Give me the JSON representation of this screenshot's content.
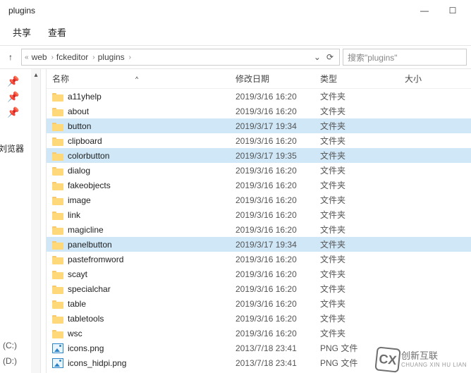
{
  "window": {
    "title": "plugins",
    "minimize": "—",
    "maximize": "☐"
  },
  "tabs": {
    "share": "共享",
    "view": "查看"
  },
  "breadcrumb": {
    "back_icon": "↑",
    "pre": "«",
    "items": [
      "web",
      "fckeditor",
      "plugins"
    ],
    "sep": "›",
    "dropdown": "⌄",
    "refresh": "⟳"
  },
  "search": {
    "placeholder": "搜索\"plugins\""
  },
  "side": {
    "cut_label": "刘览器",
    "drives": [
      "(C:)",
      "(D:)"
    ]
  },
  "columns": {
    "name": "名称",
    "date": "修改日期",
    "type": "类型",
    "size": "大小",
    "sort": "^"
  },
  "type_labels": {
    "folder": "文件夹",
    "png": "PNG 文件"
  },
  "rows": [
    {
      "icon": "folder",
      "name": "a11yhelp",
      "date": "2019/3/16 16:20",
      "type": "folder",
      "selected": false
    },
    {
      "icon": "folder",
      "name": "about",
      "date": "2019/3/16 16:20",
      "type": "folder",
      "selected": false
    },
    {
      "icon": "folder",
      "name": "button",
      "date": "2019/3/17 19:34",
      "type": "folder",
      "selected": true
    },
    {
      "icon": "folder",
      "name": "clipboard",
      "date": "2019/3/16 16:20",
      "type": "folder",
      "selected": false
    },
    {
      "icon": "folder",
      "name": "colorbutton",
      "date": "2019/3/17 19:35",
      "type": "folder",
      "selected": true
    },
    {
      "icon": "folder",
      "name": "dialog",
      "date": "2019/3/16 16:20",
      "type": "folder",
      "selected": false
    },
    {
      "icon": "folder",
      "name": "fakeobjects",
      "date": "2019/3/16 16:20",
      "type": "folder",
      "selected": false
    },
    {
      "icon": "folder",
      "name": "image",
      "date": "2019/3/16 16:20",
      "type": "folder",
      "selected": false
    },
    {
      "icon": "folder",
      "name": "link",
      "date": "2019/3/16 16:20",
      "type": "folder",
      "selected": false
    },
    {
      "icon": "folder",
      "name": "magicline",
      "date": "2019/3/16 16:20",
      "type": "folder",
      "selected": false
    },
    {
      "icon": "folder",
      "name": "panelbutton",
      "date": "2019/3/17 19:34",
      "type": "folder",
      "selected": true
    },
    {
      "icon": "folder",
      "name": "pastefromword",
      "date": "2019/3/16 16:20",
      "type": "folder",
      "selected": false
    },
    {
      "icon": "folder",
      "name": "scayt",
      "date": "2019/3/16 16:20",
      "type": "folder",
      "selected": false
    },
    {
      "icon": "folder",
      "name": "specialchar",
      "date": "2019/3/16 16:20",
      "type": "folder",
      "selected": false
    },
    {
      "icon": "folder",
      "name": "table",
      "date": "2019/3/16 16:20",
      "type": "folder",
      "selected": false
    },
    {
      "icon": "folder",
      "name": "tabletools",
      "date": "2019/3/16 16:20",
      "type": "folder",
      "selected": false
    },
    {
      "icon": "folder",
      "name": "wsc",
      "date": "2019/3/16 16:20",
      "type": "folder",
      "selected": false
    },
    {
      "icon": "img",
      "name": "icons.png",
      "date": "2013/7/18 23:41",
      "type": "png",
      "selected": false
    },
    {
      "icon": "img",
      "name": "icons_hidpi.png",
      "date": "2013/7/18 23:41",
      "type": "png",
      "selected": false
    }
  ],
  "watermark": {
    "logo": "CX",
    "text": "创新互联",
    "sub": "CHUANG XIN HU LIAN"
  }
}
